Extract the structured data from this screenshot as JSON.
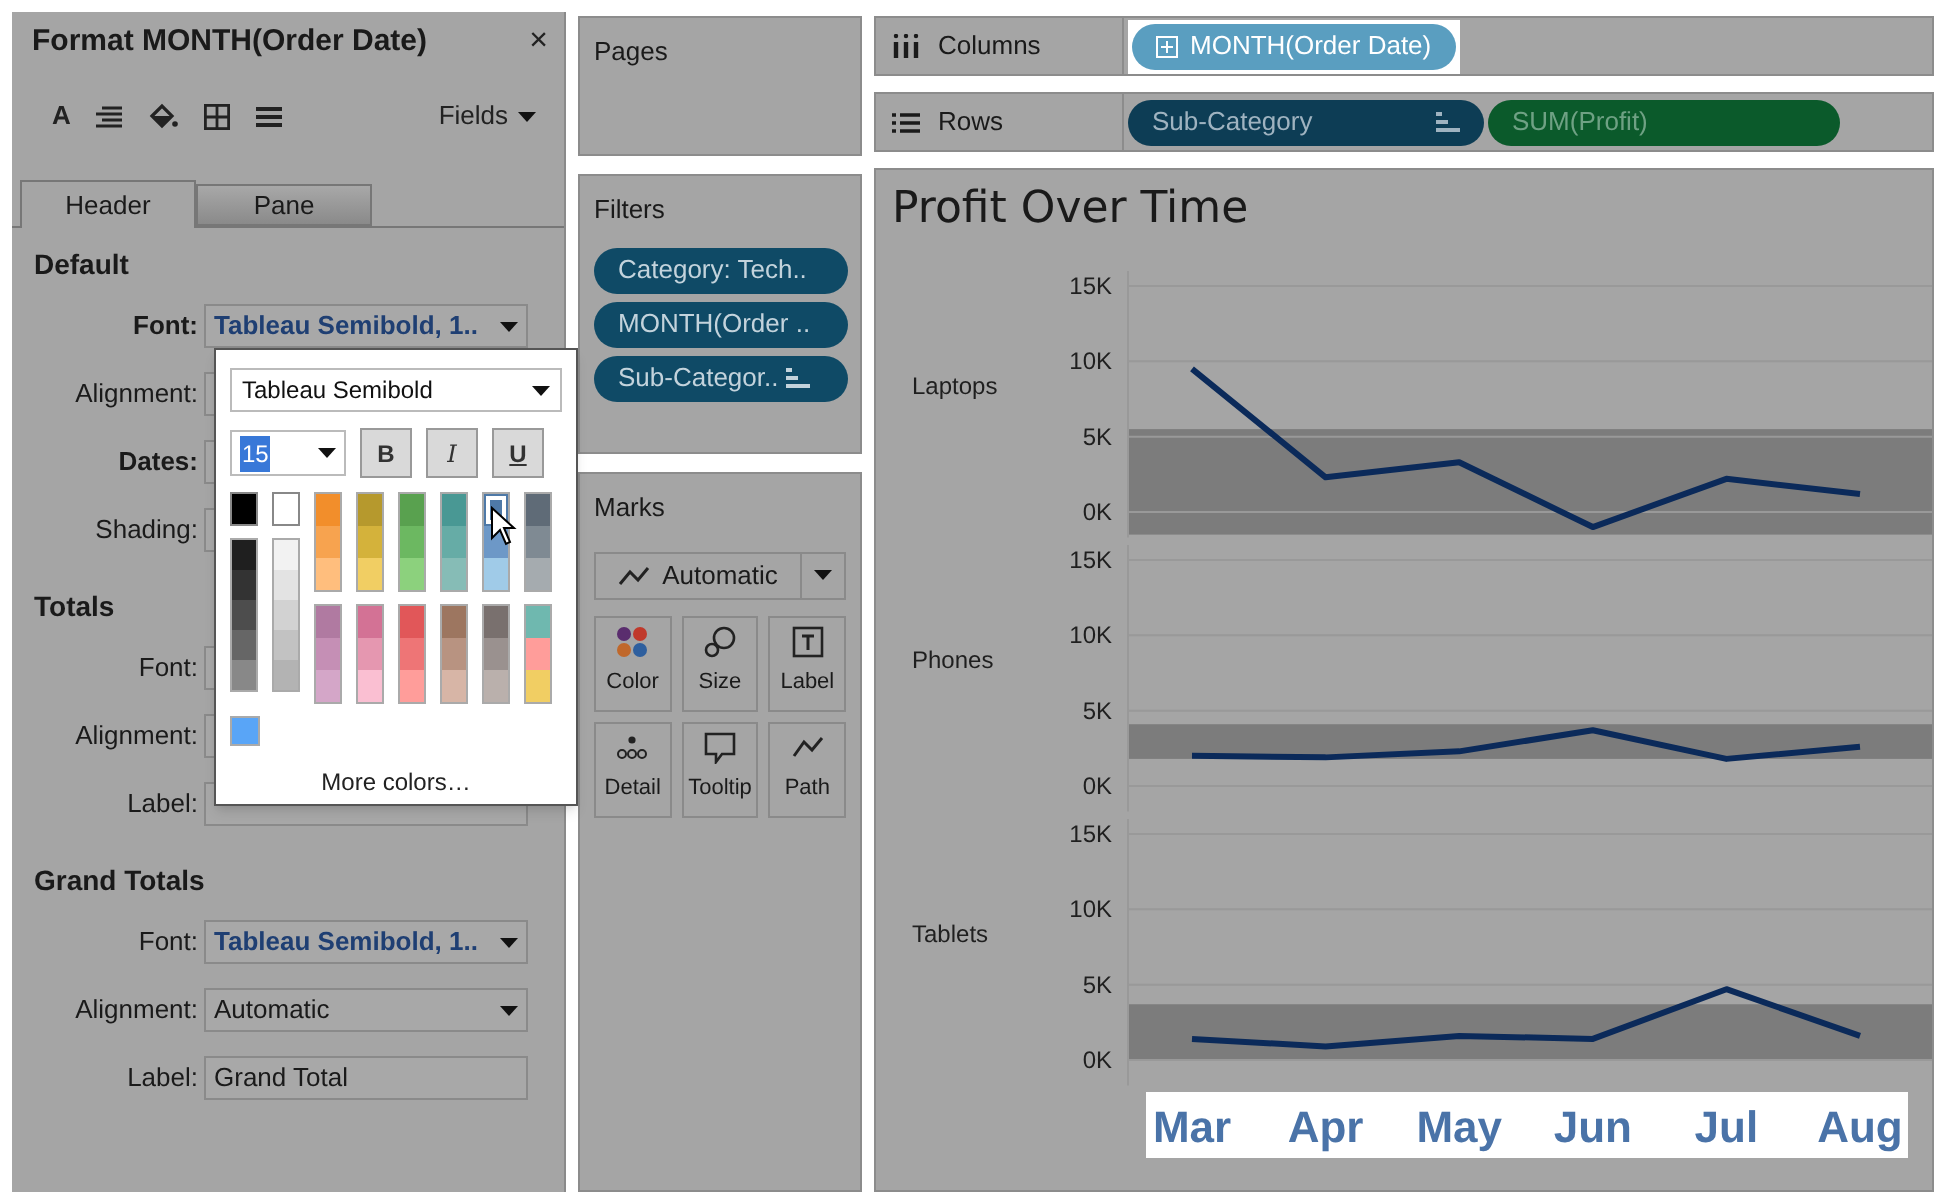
{
  "format_pane": {
    "title": "Format MONTH(Order Date)",
    "close": "×",
    "fields_menu": "Fields",
    "toolbar": [
      {
        "kind": "font",
        "glyph": "A"
      },
      {
        "kind": "alignment"
      },
      {
        "kind": "shading"
      },
      {
        "kind": "borders"
      },
      {
        "kind": "lines"
      }
    ],
    "tabs": [
      {
        "label": "Header",
        "selected": true
      },
      {
        "label": "Pane",
        "selected": false
      }
    ],
    "sections": [
      {
        "heading": "Default",
        "rows": [
          {
            "label": "Font:",
            "bold": true,
            "kind": "dropdown",
            "value": "Tableau Semibold, 1..",
            "styled": true
          },
          {
            "label": "Alignment:",
            "bold": false,
            "kind": "dropdown"
          },
          {
            "label": "Dates:",
            "bold": true,
            "kind": "dropdown"
          },
          {
            "label": "Shading:",
            "bold": false,
            "kind": "dropdown"
          }
        ]
      },
      {
        "heading": "Totals",
        "rows": [
          {
            "label": "Font:",
            "bold": false,
            "kind": "dropdown"
          },
          {
            "label": "Alignment:",
            "bold": false,
            "kind": "dropdown"
          },
          {
            "label": "Label:",
            "bold": false,
            "kind": "text"
          }
        ]
      },
      {
        "heading": "Grand Totals",
        "rows": [
          {
            "label": "Font:",
            "bold": false,
            "kind": "dropdown",
            "value": "Tableau Semibold, 1..",
            "styled": true
          },
          {
            "label": "Alignment:",
            "bold": false,
            "kind": "dropdown",
            "value": "Automatic",
            "styled": false
          },
          {
            "label": "Label:",
            "bold": false,
            "kind": "text",
            "value": "Grand Total",
            "styled": false
          }
        ]
      }
    ]
  },
  "font_popup": {
    "font_family": "Tableau Semibold",
    "size": "15",
    "style_buttons": [
      {
        "label": "B",
        "kind": "bold",
        "selected": false
      },
      {
        "label": "I",
        "kind": "italic",
        "selected": false
      },
      {
        "label": "U",
        "kind": "underline",
        "selected": false
      }
    ],
    "palette": [
      {
        "groups": [
          [
            {
              "color": "#000000",
              "selected": false
            }
          ],
          [
            {
              "color": "#1f1f1f",
              "selected": false
            },
            {
              "color": "#333333",
              "selected": false
            },
            {
              "color": "#4d4d4d",
              "selected": false
            },
            {
              "color": "#666666",
              "selected": false
            },
            {
              "color": "#888888",
              "selected": false
            }
          ]
        ]
      },
      {
        "groups": [
          [
            {
              "color": "#ffffff",
              "selected": false
            }
          ],
          [
            {
              "color": "#f2f2f2",
              "selected": false
            },
            {
              "color": "#e3e3e3",
              "selected": false
            },
            {
              "color": "#d2d2d2",
              "selected": false
            },
            {
              "color": "#c2c2c2",
              "selected": false
            },
            {
              "color": "#b3b3b3",
              "selected": false
            }
          ]
        ]
      },
      {
        "groups": [
          [
            {
              "color": "#f28e2b",
              "selected": false
            },
            {
              "color": "#f7a34f",
              "selected": false
            },
            {
              "color": "#ffbe7d",
              "selected": false
            }
          ],
          [
            {
              "color": "#b07aa1",
              "selected": false
            },
            {
              "color": "#c58fb5",
              "selected": false
            },
            {
              "color": "#d4a6c8",
              "selected": false
            }
          ]
        ]
      },
      {
        "groups": [
          [
            {
              "color": "#b6992d",
              "selected": false
            },
            {
              "color": "#d4b23b",
              "selected": false
            },
            {
              "color": "#f1ce63",
              "selected": false
            }
          ],
          [
            {
              "color": "#d37295",
              "selected": false
            },
            {
              "color": "#e597b0",
              "selected": false
            },
            {
              "color": "#fabfd2",
              "selected": false
            }
          ]
        ]
      },
      {
        "groups": [
          [
            {
              "color": "#59a14f",
              "selected": false
            },
            {
              "color": "#6cb861",
              "selected": false
            },
            {
              "color": "#8cd17d",
              "selected": false
            }
          ],
          [
            {
              "color": "#e15759",
              "selected": false
            },
            {
              "color": "#ee7576",
              "selected": false
            },
            {
              "color": "#ff9d9a",
              "selected": false
            }
          ]
        ]
      },
      {
        "groups": [
          [
            {
              "color": "#499894",
              "selected": false
            },
            {
              "color": "#66aca6",
              "selected": false
            },
            {
              "color": "#86bcb6",
              "selected": false
            }
          ],
          [
            {
              "color": "#9d7660",
              "selected": false
            },
            {
              "color": "#b89381",
              "selected": false
            },
            {
              "color": "#d7b5a6",
              "selected": false
            }
          ]
        ]
      },
      {
        "groups": [
          [
            {
              "color": "#4e79a7",
              "selected": true
            },
            {
              "color": "#6d98c7",
              "selected": false
            },
            {
              "color": "#a0cbe8",
              "selected": false
            }
          ],
          [
            {
              "color": "#79706e",
              "selected": false
            },
            {
              "color": "#9a918f",
              "selected": false
            },
            {
              "color": "#bab0ac",
              "selected": false
            }
          ]
        ]
      },
      {
        "groups": [
          [
            {
              "color": "#5f6b77",
              "selected": false
            },
            {
              "color": "#7f8a93",
              "selected": false
            },
            {
              "color": "#a5abaf",
              "selected": false
            }
          ],
          [
            {
              "color": "#6fb8af",
              "selected": false
            },
            {
              "color": "#ff9d9a",
              "selected": false
            },
            {
              "color": "#f1ce63",
              "selected": false
            }
          ]
        ]
      }
    ],
    "custom_color": {
      "color": "#59a5f7"
    },
    "more_colors": "More colors…"
  },
  "pages": {
    "title": "Pages"
  },
  "filters": {
    "title": "Filters",
    "pills": [
      {
        "label": "Category: Tech..",
        "sort_icon": false
      },
      {
        "label": "MONTH(Order ..",
        "sort_icon": false
      },
      {
        "label": "Sub-Categor..",
        "sort_icon": true
      }
    ]
  },
  "marks": {
    "title": "Marks",
    "mark_type": "Automatic",
    "cards": [
      {
        "label": "Color",
        "kind": "color"
      },
      {
        "label": "Size",
        "kind": "size"
      },
      {
        "label": "Label",
        "kind": "label"
      },
      {
        "label": "Detail",
        "kind": "detail"
      },
      {
        "label": "Tooltip",
        "kind": "tooltip"
      },
      {
        "label": "Path",
        "kind": "path"
      }
    ]
  },
  "shelves": [
    {
      "label": "Columns",
      "kind": "columns",
      "pills": [
        {
          "label": "MONTH(Order Date)",
          "kind": "date",
          "highlighted": true,
          "sort_icon": false
        }
      ]
    },
    {
      "label": "Rows",
      "kind": "rows",
      "pills": [
        {
          "label": "Sub-Category",
          "kind": "dimension",
          "highlighted": false,
          "sort_icon": true
        },
        {
          "label": "SUM(Profit)",
          "kind": "measure",
          "highlighted": false,
          "sort_icon": false
        }
      ]
    }
  ],
  "view": {
    "title": "Profit Over Time",
    "panels": [
      {
        "chart_data": {
          "type": "line",
          "grid": true,
          "ylim": [
            -1700,
            16000
          ],
          "yticks": [
            {
              "value": 0,
              "label": "0K"
            },
            {
              "value": 5000,
              "label": "5K"
            },
            {
              "value": 10000,
              "label": "10K"
            },
            {
              "value": 15000,
              "label": "15K"
            }
          ],
          "series": [
            {
              "name": "Laptops",
              "color": "#0b2a5a",
              "values": [
                9500,
                2300,
                3300,
                -1000,
                2200,
                1200
              ]
            }
          ]
        }
      },
      {
        "chart_data": {
          "type": "line",
          "grid": true,
          "ylim": [
            -1700,
            16000
          ],
          "yticks": [
            {
              "value": 0,
              "label": "0K"
            },
            {
              "value": 5000,
              "label": "5K"
            },
            {
              "value": 10000,
              "label": "10K"
            },
            {
              "value": 15000,
              "label": "15K"
            }
          ],
          "series": [
            {
              "name": "Phones",
              "color": "#0b2a5a",
              "values": [
                2000,
                1900,
                2300,
                3700,
                1800,
                2600
              ]
            }
          ]
        }
      },
      {
        "chart_data": {
          "type": "line",
          "grid": true,
          "ylim": [
            -1700,
            16000
          ],
          "categories": [
            "Mar",
            "Apr",
            "May",
            "Jun",
            "Jul",
            "Aug"
          ],
          "yticks": [
            {
              "value": 0,
              "label": "0K"
            },
            {
              "value": 5000,
              "label": "5K"
            },
            {
              "value": 10000,
              "label": "10K"
            },
            {
              "value": 15000,
              "label": "15K"
            }
          ],
          "series": [
            {
              "name": "Tablets",
              "color": "#0b2a5a",
              "values": [
                1400,
                900,
                1600,
                1400,
                4700,
                1600
              ]
            }
          ]
        }
      }
    ]
  }
}
